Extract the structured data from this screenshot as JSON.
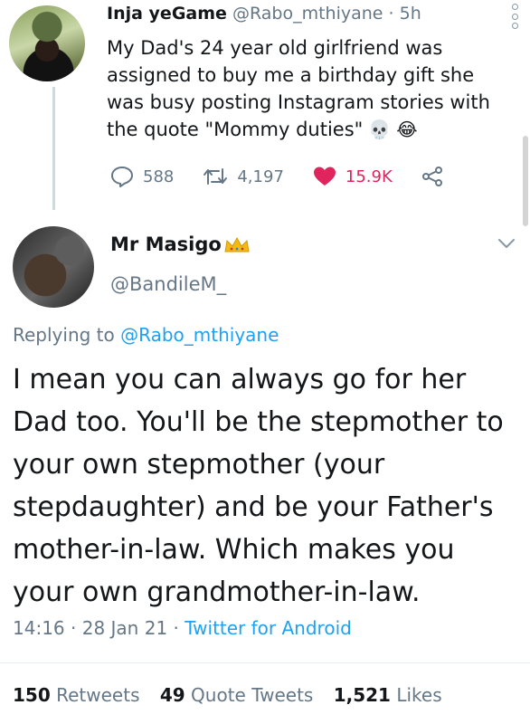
{
  "tweet": {
    "name": "Inja yeGame",
    "handle": "@Rabo_mthiyane",
    "separator": "·",
    "time": "5h",
    "text": "My Dad's 24 year old girlfriend was assigned to buy me a birthday gift she was busy posting Instagram stories with the quote \"Mommy duties\"",
    "emoji_1": "💀",
    "emoji_2": "😂",
    "replies": "588",
    "retweets": "4,197",
    "likes": "15.9K"
  },
  "reply": {
    "name": "Mr Masigo",
    "handle": "@BandileM_",
    "replying_prefix": "Replying to",
    "replying_to": "@Rabo_mthiyane",
    "text": "I mean you can always go for her Dad too. You'll be the stepmother to your own stepmother (your stepdaughter) and be your Father's mother-in-law. Which makes you your own grandmother-in-law.",
    "time": "14:16",
    "separator_1": "·",
    "date": "28 Jan 21",
    "separator_2": "·",
    "source": "Twitter for Android",
    "retweets_count": "150",
    "retweets_label": "Retweets",
    "quotes_count": "49",
    "quotes_label": "Quote Tweets",
    "likes_count": "1,521",
    "likes_label": "Likes"
  },
  "colors": {
    "accent": "#1da1f2",
    "muted": "#657786",
    "like": "#e0245e",
    "text": "#14171a"
  },
  "icons": [
    "more-icon",
    "reply-icon",
    "retweet-icon",
    "heart-icon",
    "share-icon",
    "crown-icon",
    "chevron-down-icon"
  ]
}
